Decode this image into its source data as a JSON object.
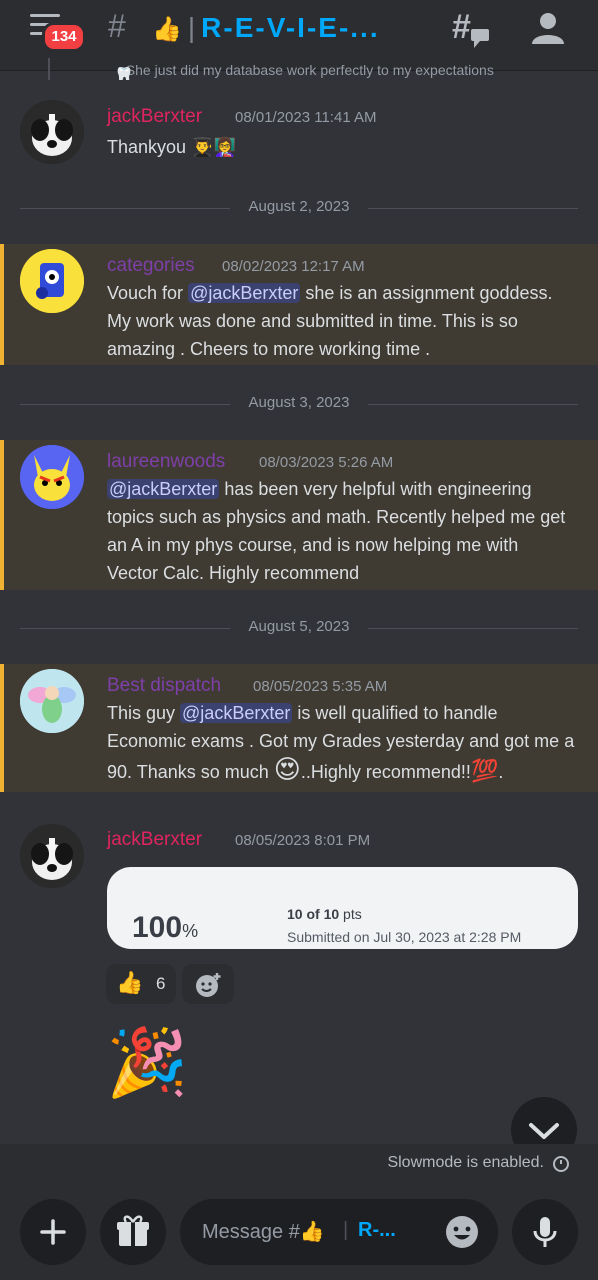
{
  "header": {
    "unread_count": "134",
    "channel_emoji": "👍",
    "channel_name": "R-E-V-I-E-..."
  },
  "top_partial": {
    "text": ": She just did my database work perfectly to my expectations"
  },
  "messages": [
    {
      "username": "jackBerxter",
      "timestamp": "08/01/2023 11:41 AM",
      "text": "Thankyou",
      "emojis": "👨‍🎓👩‍🏫"
    },
    {
      "username": "categories",
      "timestamp": "08/02/2023 12:17 AM",
      "line1_pre": "Vouch for ",
      "mention": "@jackBerxter",
      "line1_post": "  she is an assignment goddess.",
      "line2": "My work was done and submitted in time. This is so",
      "line3": "amazing . Cheers to more working time ."
    },
    {
      "username": "laureenwoods",
      "timestamp": "08/03/2023 5:26 AM",
      "mention": "@jackBerxter",
      "line1_post": "  has been very helpful with engineering",
      "line2": "topics such as physics and math. Recently helped me get",
      "line3": "an A in my phys course, and is now helping me with",
      "line4": "Vector Calc. Highly recommend"
    },
    {
      "username": "Best dispatch",
      "timestamp": "08/05/2023 5:35 AM",
      "line1_pre": "This guy ",
      "mention": "@jackBerxter",
      "line1_post": "  is well qualified to handle",
      "line2": "Economic exams . Got my Grades yesterday  and got me a",
      "line3_pre": "90. Thanks so much ",
      "line3_emoji": "😍",
      "line3_mid": "..Highly recommend!!",
      "line3_emoji2": "💯",
      "line3_end": "."
    },
    {
      "username": "jackBerxter",
      "timestamp": "08/05/2023 8:01 PM",
      "card_score": "100",
      "card_score_unit": "%",
      "card_pts_value": "10 of 10",
      "card_pts_unit": " pts",
      "card_submitted": "Submitted on Jul 30, 2023 at 2:28 PM",
      "reaction_emoji": "👍",
      "reaction_count": "6",
      "big_emoji": "🎉"
    }
  ],
  "dividers": [
    "August 2, 2023",
    "August 3, 2023",
    "August 5, 2023"
  ],
  "slowmode_text": "Slowmode is enabled.",
  "composer": {
    "placeholder": "Message #👍",
    "channel_suffix": "R-..."
  },
  "colors": {
    "username_red": "#e0245e",
    "username_purple": "#7e3fa8",
    "mention_bg": "#3c4270",
    "highlight_bar": "#f0b232"
  }
}
